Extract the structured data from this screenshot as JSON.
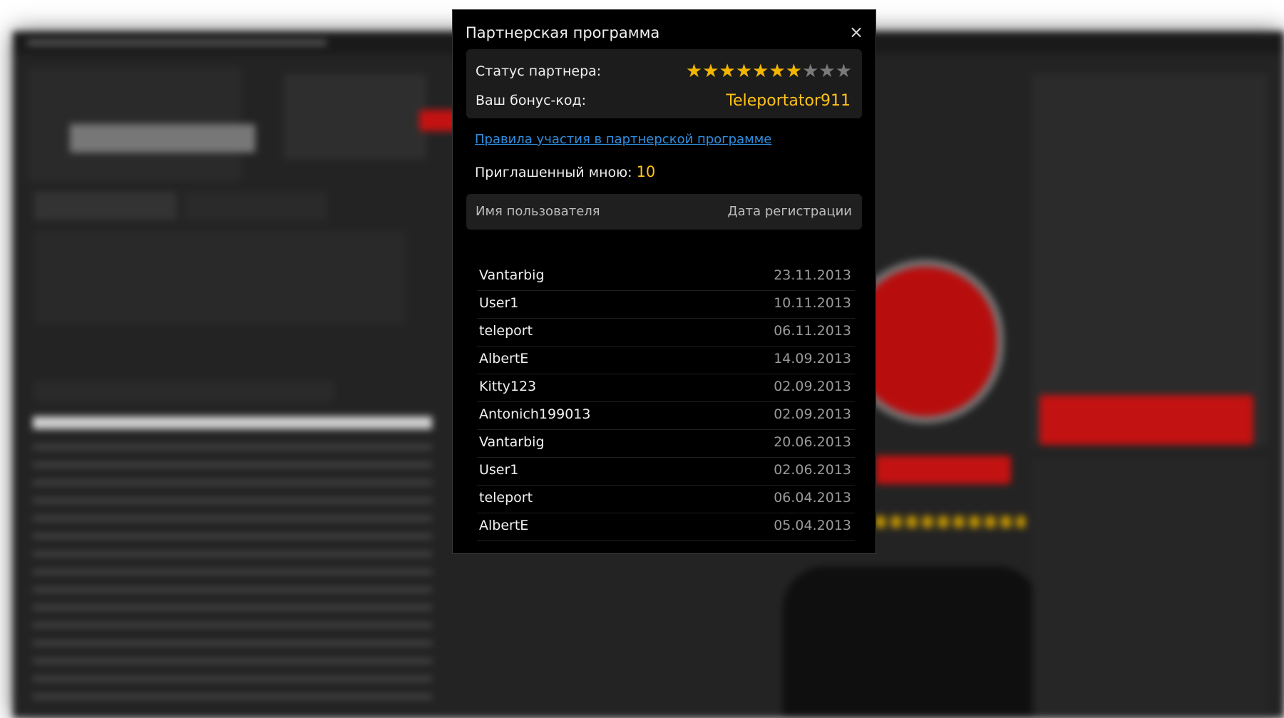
{
  "modal": {
    "title": "Партнерская программа",
    "close_label": "×",
    "status_label": "Статус партнера:",
    "stars_total": 10,
    "stars_filled": 7,
    "bonus_label": "Ваш бонус-код:",
    "bonus_code": "Teleportator911",
    "rules_link": "Правила участия в партнерской программе",
    "invited_label": "Приглашенный мною:",
    "invited_count": "10",
    "columns": {
      "username": "Имя пользователя",
      "reg_date": "Дата регистрации"
    },
    "users": [
      {
        "name": "Vantarbig",
        "date": "23.11.2013"
      },
      {
        "name": "User1",
        "date": "10.11.2013"
      },
      {
        "name": "teleport",
        "date": "06.11.2013"
      },
      {
        "name": "AlbertE",
        "date": "14.09.2013"
      },
      {
        "name": "Kitty123",
        "date": "02.09.2013"
      },
      {
        "name": "Antonich199013",
        "date": "02.09.2013"
      },
      {
        "name": "Vantarbig",
        "date": "20.06.2013"
      },
      {
        "name": "User1",
        "date": "02.06.2013"
      },
      {
        "name": "teleport",
        "date": "06.04.2013"
      },
      {
        "name": "AlbertE",
        "date": "05.04.2013"
      }
    ]
  },
  "colors": {
    "accent_gold": "#ffc21a",
    "star_on": "#f3b600",
    "star_off": "#7a7a7a",
    "link": "#2f8ee0"
  }
}
